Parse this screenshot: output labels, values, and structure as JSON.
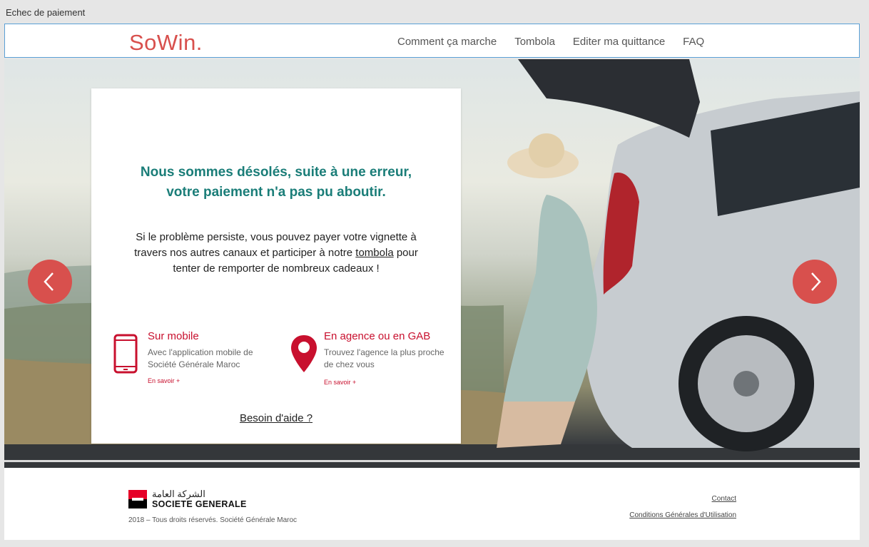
{
  "window": {
    "title": "Echec de paiement"
  },
  "header": {
    "logo": "SoWin.",
    "nav": [
      "Comment ça marche",
      "Tombola",
      "Editer ma quittance",
      "FAQ"
    ]
  },
  "card": {
    "title_line1": "Nous sommes désolés, suite à une erreur,",
    "title_line2": "votre paiement n'a pas pu aboutir.",
    "body_before": "Si le problème persiste, vous pouvez payer votre vignette à travers nos autres canaux et participer à notre ",
    "body_link": "tombola",
    "body_after": " pour tenter de remporter de nombreux cadeaux !",
    "channels": [
      {
        "title": "Sur mobile",
        "description": "Avec l'application mobile de Société Générale Maroc",
        "more": "En savoir +",
        "icon": "mobile-phone-icon"
      },
      {
        "title": "En agence ou en GAB",
        "description": "Trouvez l'agence la plus proche de chez vous",
        "more": "En savoir +",
        "icon": "map-pin-icon"
      }
    ],
    "help_link": "Besoin d'aide ?"
  },
  "carousel": {
    "prev_icon": "chevron-left-icon",
    "next_icon": "chevron-right-icon"
  },
  "footer": {
    "brand_arabic": "الشركة العامة",
    "brand_name": "SOCIETE GENERALE",
    "copyright": "2018 – Tous droits réservés. Société Générale Maroc",
    "links": [
      "Contact",
      "Conditions Générales d'Utilisation"
    ]
  },
  "colors": {
    "brand_red": "#d8504d",
    "accent_red": "#c8102e",
    "title_teal": "#1a7d78"
  }
}
